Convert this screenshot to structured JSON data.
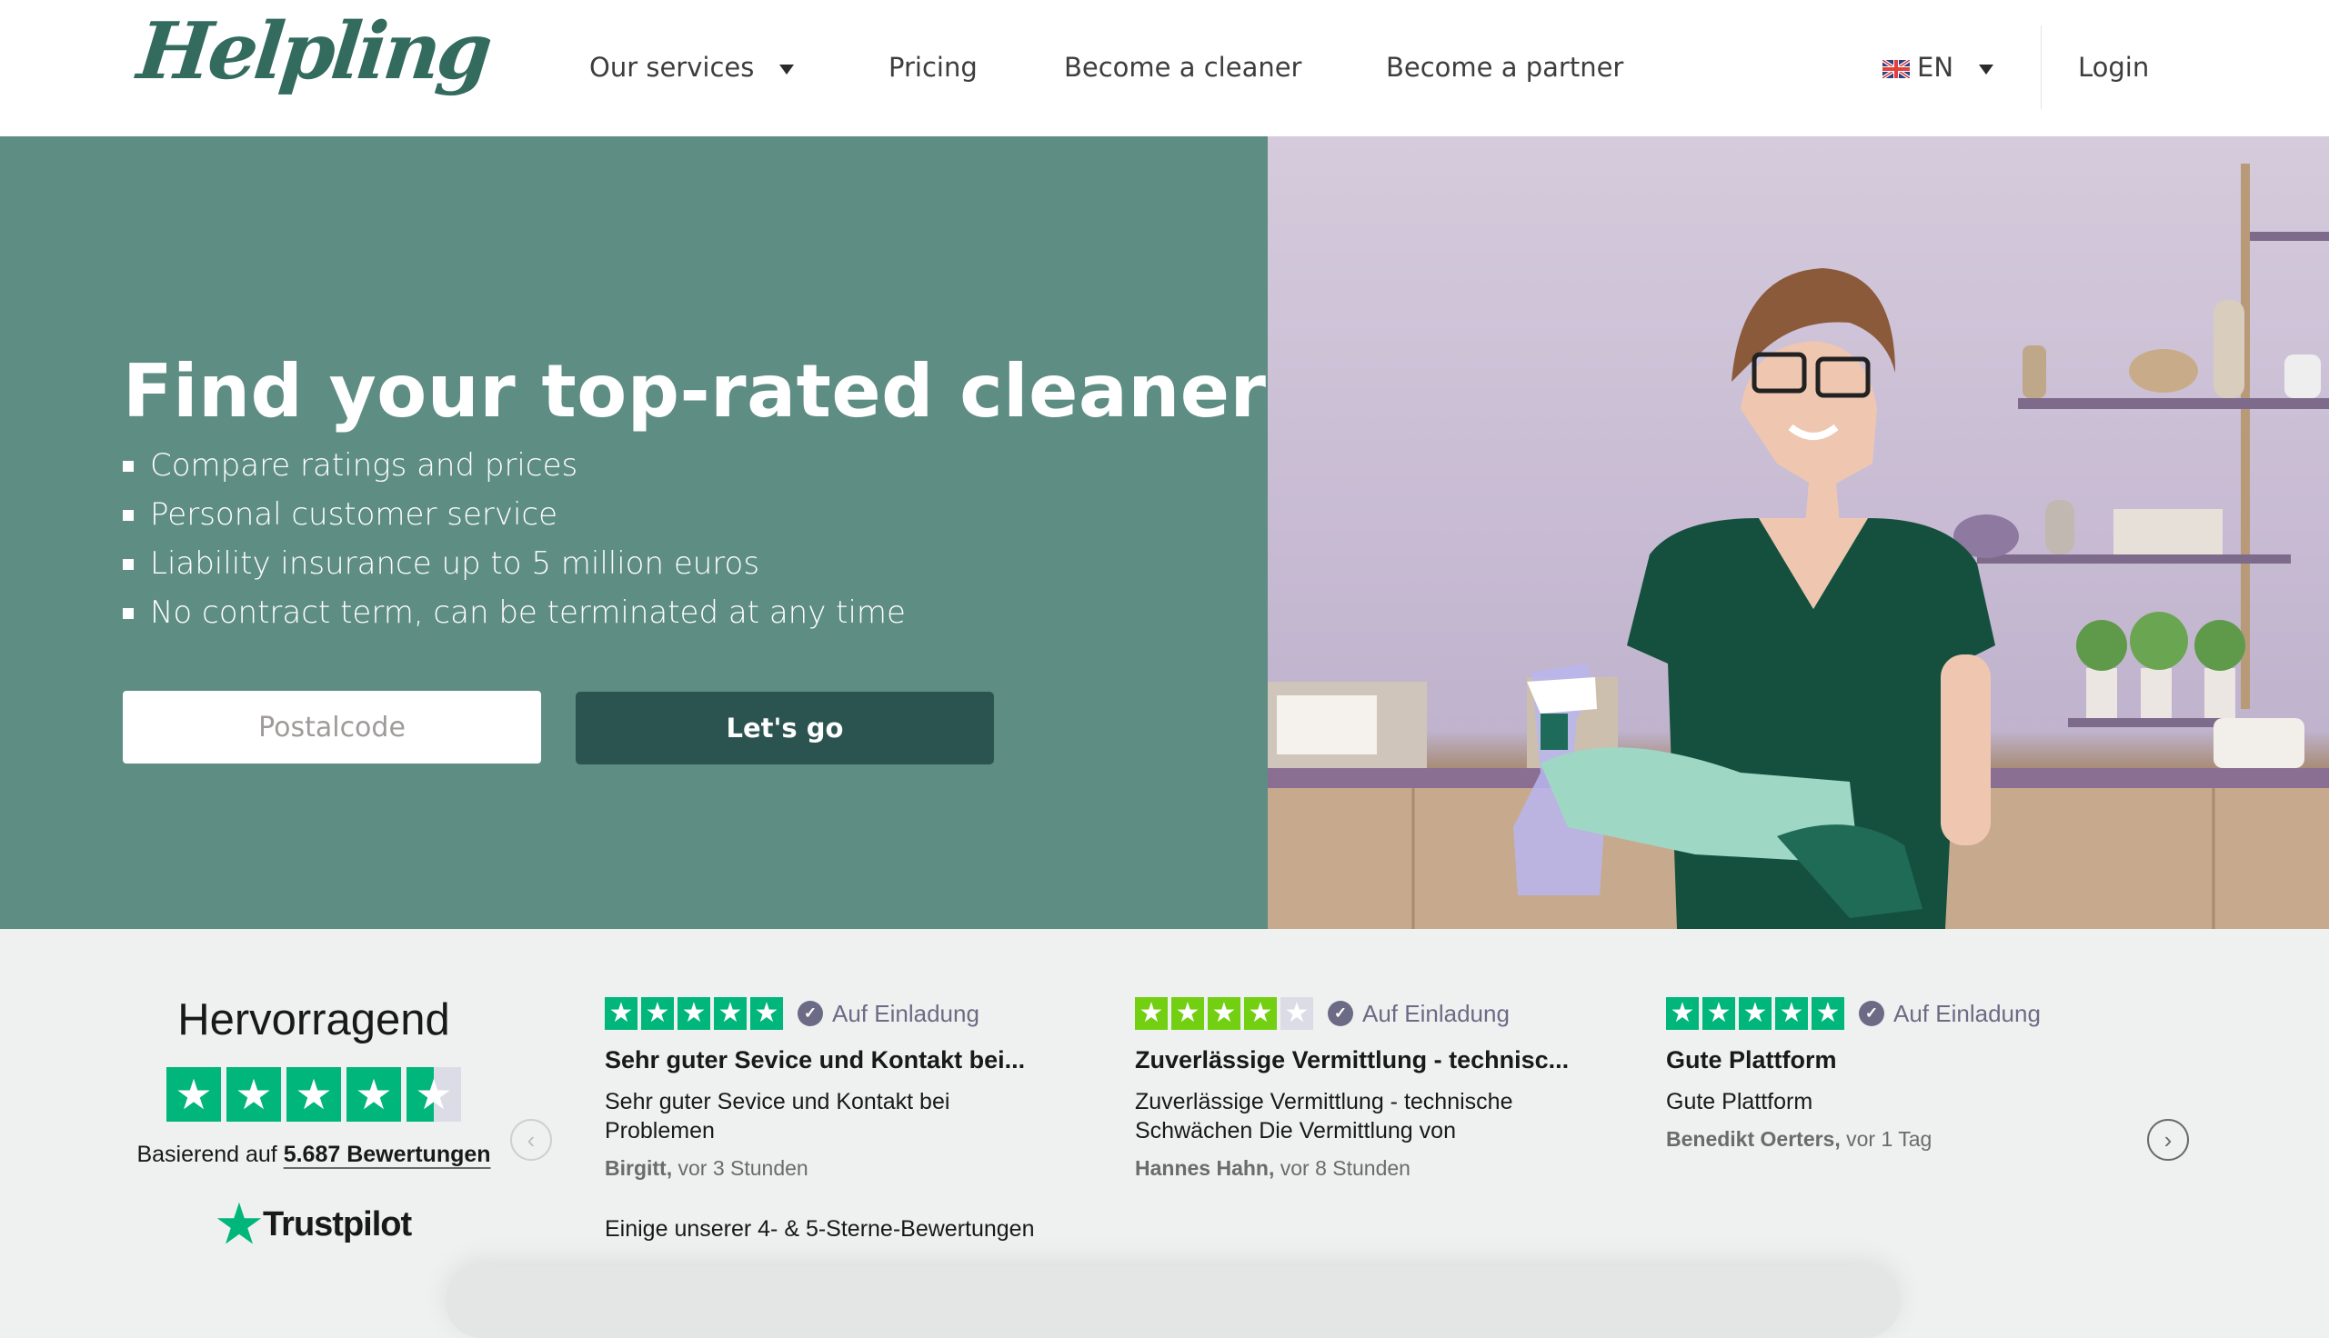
{
  "header": {
    "logo": "Helpling",
    "nav": [
      {
        "label": "Our services",
        "has_dropdown": true
      },
      {
        "label": "Pricing"
      },
      {
        "label": "Become a cleaner"
      },
      {
        "label": "Become a partner"
      }
    ],
    "language": {
      "code": "EN",
      "flag_icon": "uk-flag-icon"
    },
    "login_label": "Login"
  },
  "hero": {
    "title": "Find your top-rated cleaner",
    "bullets": [
      "Compare ratings and prices",
      "Personal customer service",
      "Liability insurance up to 5 million euros",
      "No contract term, can be terminated at any time"
    ],
    "postal_placeholder": "Postalcode",
    "postal_value": "",
    "cta_label": "Let's go",
    "colors": {
      "panel": "#5e8d84",
      "cta": "#2b5450"
    }
  },
  "trustpilot": {
    "rating_word": "Hervorragend",
    "stars": 4.5,
    "based_on_prefix": "Basierend auf",
    "review_count_label": "5.687 Bewertungen",
    "brand": "Trustpilot",
    "brand_color": "#00b67a",
    "footnote": "Einige unserer 4- & 5-Sterne-Bewertungen",
    "reviews": [
      {
        "stars": 5,
        "verified_label": "Auf Einladung",
        "title": "Sehr guter Sevice und Kontakt bei...",
        "body": "Sehr guter Sevice und Kontakt bei Problemen",
        "author": "Birgitt,",
        "time": "vor 3 Stunden"
      },
      {
        "stars": 4,
        "verified_label": "Auf Einladung",
        "title": "Zuverlässige Vermittlung - technisc...",
        "body": "Zuverlässige Vermittlung - technische Schwächen Die Vermittlung von",
        "author": "Hannes Hahn,",
        "time": "vor 8 Stunden"
      },
      {
        "stars": 5,
        "verified_label": "Auf Einladung",
        "title": "Gute Plattform",
        "body": "Gute Plattform",
        "author": "Benedikt Oerters,",
        "time": "vor 1 Tag"
      }
    ]
  }
}
